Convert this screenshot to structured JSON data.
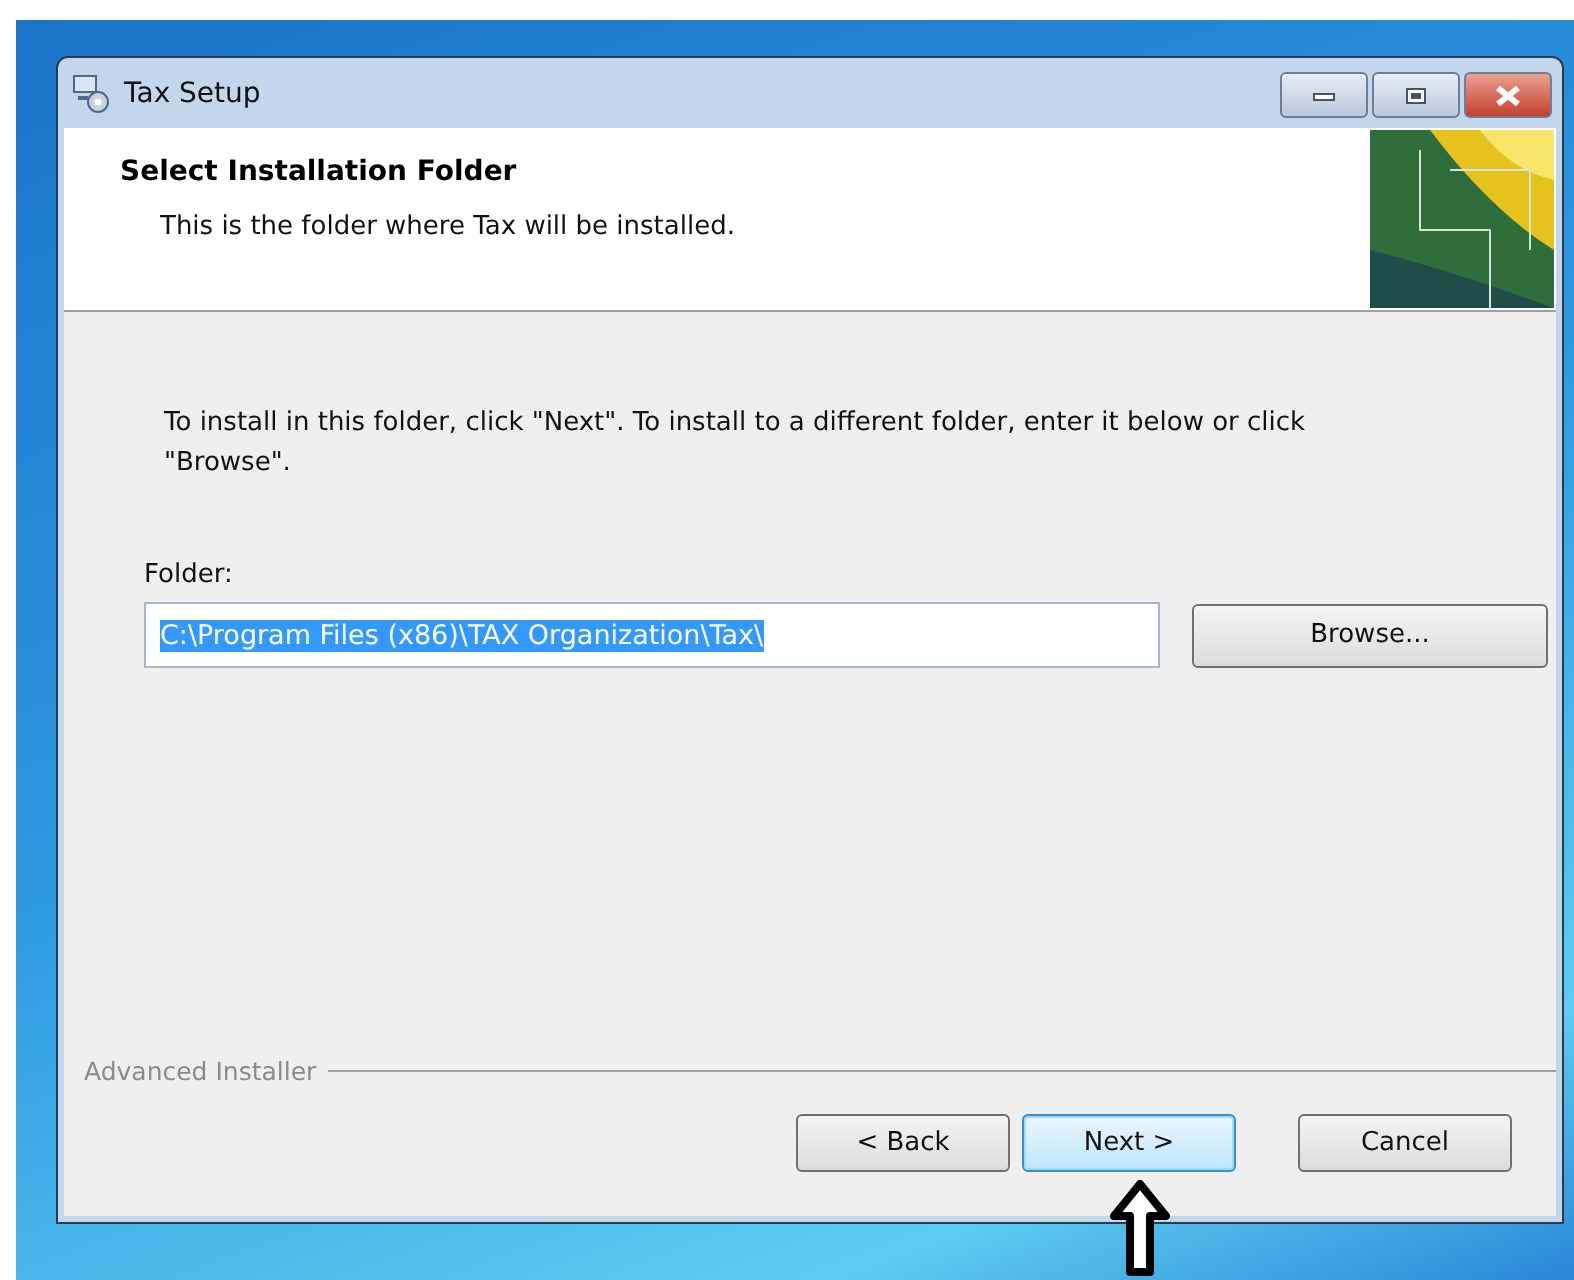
{
  "window": {
    "title": "Tax Setup"
  },
  "header": {
    "title": "Select Installation Folder",
    "subtitle": "This is the folder where Tax will be installed."
  },
  "instruction": "To install in this folder, click \"Next\". To install to a different folder, enter it below or click \"Browse\".",
  "folder": {
    "label": "Folder:",
    "value": "C:\\Program Files (x86)\\TAX Organization\\Tax\\",
    "text_selected": true
  },
  "browse_button": "Browse...",
  "branding": "Advanced Installer",
  "buttons": [
    {
      "label": "< Back",
      "focused": false
    },
    {
      "label": "Next >",
      "focused": true
    },
    {
      "label": "Cancel",
      "focused": false
    }
  ]
}
